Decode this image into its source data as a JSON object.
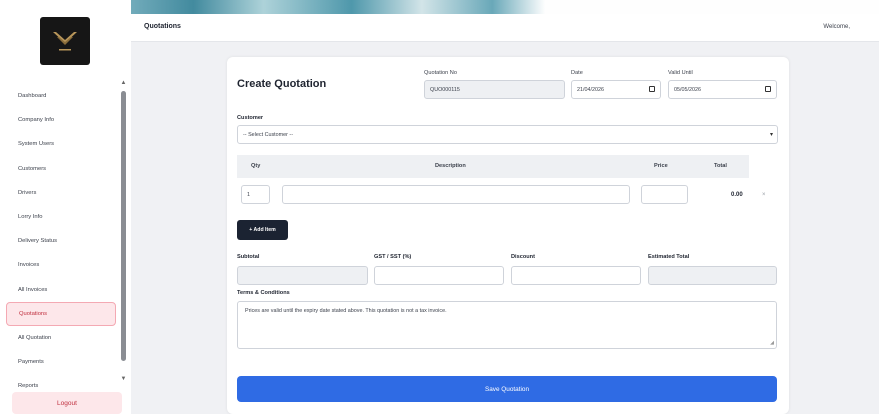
{
  "sidebar": {
    "items": [
      {
        "label": "Dashboard"
      },
      {
        "label": "Company Info"
      },
      {
        "label": "System Users"
      },
      {
        "label": "Customers"
      },
      {
        "label": "Drivers"
      },
      {
        "label": "Lorry Info"
      },
      {
        "label": "Delivery Status"
      },
      {
        "label": "Invoices"
      },
      {
        "label": "All Invoices"
      },
      {
        "label": "Quotations",
        "active": true
      },
      {
        "label": "All Quotation"
      },
      {
        "label": "Payments"
      },
      {
        "label": "Reports"
      }
    ],
    "logout_label": "Logout"
  },
  "header": {
    "title": "Quotations",
    "welcome": "Welcome,"
  },
  "form": {
    "title": "Create Quotation",
    "quotation_no_label": "Quotation No",
    "quotation_no_value": "QUO000115",
    "date_label": "Date",
    "date_value": "21/04/2026",
    "valid_until_label": "Valid Until",
    "valid_until_value": "05/05/2026",
    "customer_label": "Customer",
    "customer_selected": "-- Select Customer --",
    "table": {
      "headers": [
        "Qty",
        "Description",
        "Price",
        "Total"
      ],
      "rows": [
        {
          "qty": "1",
          "description": "",
          "price": "",
          "total": "0.00",
          "remove": "×"
        }
      ]
    },
    "add_item_label": "+ Add Item",
    "subtotal_label": "Subtotal",
    "gst_label": "GST / SST (%)",
    "discount_label": "Discount",
    "estimated_total_label": "Estimated Total",
    "terms_label": "Terms & Conditions",
    "terms_value": "Prices are valid until the expiry date stated above. This quotation is not a tax invoice.",
    "save_label": "Save Quotation"
  },
  "colors": {
    "primary": "#2f6be4",
    "dark_button": "#1b2332",
    "active_nav_bg": "#fde7ea",
    "active_nav_text": "#c0303f"
  }
}
